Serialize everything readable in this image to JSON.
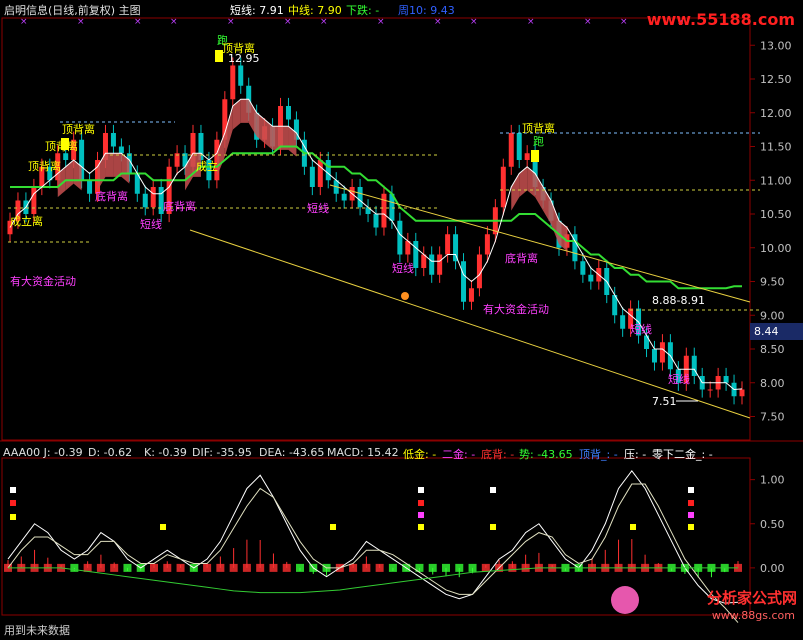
{
  "header": {
    "title": "启明信息(日线,前复权) 主图",
    "short_label": "短线: 7.91",
    "mid_label": "中线: 7.90",
    "down_label": "下跌: -",
    "week_label": "周10: 9.43"
  },
  "brand": {
    "site_top": "www.55188.com",
    "site_bottom_cn": "分析家公式网",
    "site_bottom_url": "www.88gs.com"
  },
  "sub_header": {
    "aaa": "AAA00 J: -0.39",
    "d": "D: -0.62",
    "k": "K: -0.39",
    "dif": "DIF: -35.95",
    "dea": "DEA: -43.65",
    "macd": "MACD: 15.42",
    "low_gold": "低金: -",
    "two_gold": "二金: -",
    "bottom_div": "底背: -",
    "trend": "势: -43.65",
    "top_div": "顶背_: -",
    "press": "压: -",
    "zero_below": "零下二金_: -"
  },
  "bottom_note": "用到未来数据",
  "current_price": "8.44",
  "colors": {
    "up": "#ff3030",
    "down": "#00c0c0",
    "mid": "#33dd33",
    "short": "#ffffff",
    "ribbon": "#c85050",
    "yellow": "#ffff00",
    "magenta": "#ff40ff",
    "green_label": "#33ff33"
  },
  "annotations": [
    {
      "text": "顶背离",
      "color": "#ffff00"
    },
    {
      "text": "顶背离",
      "color": "#ffff00"
    },
    {
      "text": "顶背离",
      "color": "#ffff00"
    },
    {
      "text": "成立离",
      "color": "#ffff00"
    },
    {
      "text": "底背离",
      "color": "#ff40ff"
    },
    {
      "text": "底背离",
      "color": "#ff40ff"
    },
    {
      "text": "短线",
      "color": "#ff40ff"
    },
    {
      "text": "成立",
      "color": "#ffff00"
    },
    {
      "text": "跑",
      "color": "#33ff33"
    },
    {
      "text": "顶背离",
      "color": "#ffff00"
    },
    {
      "text": "12.95",
      "color": "#ffffff"
    },
    {
      "text": "短线",
      "color": "#ff40ff"
    },
    {
      "text": "短线",
      "color": "#ff40ff"
    },
    {
      "text": "有大资金活动",
      "color": "#ff40ff"
    },
    {
      "text": "有大资金活动",
      "color": "#ff40ff"
    },
    {
      "text": "底背离",
      "color": "#ff40ff"
    },
    {
      "text": "顶背离",
      "color": "#ffff00"
    },
    {
      "text": "跑",
      "color": "#33ff33"
    },
    {
      "text": "8.88-8.91",
      "color": "#ffffff"
    },
    {
      "text": "短线",
      "color": "#ff40ff"
    },
    {
      "text": "短线",
      "color": "#ff40ff"
    },
    {
      "text": "7.51",
      "color": "#ffffff"
    }
  ],
  "chart_data": [
    {
      "type": "candlestick",
      "title": "启明信息(日线,前复权) 主图",
      "ylim": [
        7.3,
        13.3
      ],
      "yticks": [
        "7.50",
        "8.00",
        "8.50",
        "9.00",
        "9.50",
        "10.00",
        "10.50",
        "11.00",
        "11.50",
        "12.00",
        "12.50",
        "13.00"
      ],
      "close": [
        10.4,
        10.7,
        10.5,
        10.9,
        11.2,
        11.0,
        11.4,
        11.3,
        11.6,
        11.0,
        10.8,
        11.3,
        11.7,
        11.5,
        11.4,
        11.1,
        10.8,
        10.6,
        10.9,
        10.5,
        11.2,
        11.4,
        11.2,
        11.7,
        11.3,
        11.0,
        11.6,
        12.2,
        12.7,
        12.4,
        12.0,
        11.6,
        11.8,
        11.5,
        12.1,
        11.9,
        11.6,
        11.2,
        10.9,
        11.3,
        11.0,
        10.8,
        10.7,
        10.9,
        10.6,
        10.5,
        10.3,
        10.8,
        10.4,
        9.9,
        10.1,
        9.7,
        9.9,
        9.6,
        9.9,
        10.2,
        9.8,
        9.2,
        9.4,
        9.9,
        10.2,
        10.6,
        11.2,
        11.7,
        11.3,
        11.4,
        10.9,
        10.7,
        10.4,
        10.0,
        10.2,
        9.8,
        9.6,
        9.5,
        9.7,
        9.3,
        9.0,
        8.8,
        9.1,
        8.7,
        8.5,
        8.3,
        8.6,
        8.2,
        8.0,
        8.4,
        8.1,
        7.9,
        7.9,
        8.1,
        8.0,
        7.8,
        7.9
      ],
      "series": [
        {
          "name": "短线",
          "values": [
            10.3,
            10.5,
            10.6,
            10.8,
            10.9,
            11.0,
            11.1,
            11.2,
            11.3,
            11.2,
            11.1,
            11.2,
            11.4,
            11.4,
            11.4,
            11.3,
            11.1,
            10.9,
            10.8,
            10.8,
            10.9,
            11.1,
            11.2,
            11.4,
            11.4,
            11.3,
            11.4,
            11.7,
            12.1,
            12.2,
            12.2,
            12.0,
            11.9,
            11.8,
            11.8,
            11.8,
            11.7,
            11.5,
            11.3,
            11.2,
            11.1,
            11.0,
            10.9,
            10.8,
            10.7,
            10.6,
            10.5,
            10.5,
            10.4,
            10.2,
            10.1,
            10.0,
            9.9,
            9.8,
            9.8,
            9.9,
            9.9,
            9.6,
            9.5,
            9.6,
            9.8,
            10.1,
            10.5,
            10.9,
            11.1,
            11.2,
            11.1,
            10.9,
            10.7,
            10.4,
            10.3,
            10.1,
            9.9,
            9.7,
            9.6,
            9.5,
            9.3,
            9.1,
            9.0,
            8.9,
            8.7,
            8.5,
            8.5,
            8.4,
            8.2,
            8.2,
            8.2,
            8.0,
            8.0,
            8.0,
            8.0,
            7.9,
            7.91
          ]
        },
        {
          "name": "中线",
          "values": [
            10.9,
            10.9,
            10.9,
            10.9,
            10.9,
            10.9,
            10.9,
            11.0,
            11.0,
            11.0,
            11.0,
            11.0,
            11.0,
            11.0,
            11.1,
            11.1,
            11.1,
            11.1,
            11.0,
            11.0,
            11.0,
            11.0,
            11.0,
            11.1,
            11.2,
            11.2,
            11.2,
            11.3,
            11.4,
            11.4,
            11.4,
            11.4,
            11.4,
            11.4,
            11.5,
            11.5,
            11.5,
            11.4,
            11.4,
            11.3,
            11.2,
            11.2,
            11.2,
            11.1,
            11.1,
            11.0,
            11.0,
            10.9,
            10.8,
            10.6,
            10.5,
            10.4,
            10.4,
            10.4,
            10.4,
            10.4,
            10.4,
            10.4,
            10.4,
            10.4,
            10.4,
            10.4,
            10.4,
            10.4,
            10.5,
            10.5,
            10.5,
            10.4,
            10.3,
            10.2,
            10.1,
            10.1,
            10.0,
            9.9,
            9.9,
            9.8,
            9.7,
            9.7,
            9.6,
            9.6,
            9.5,
            9.5,
            9.5,
            9.5,
            9.4,
            9.4,
            9.4,
            9.4,
            9.4,
            9.4,
            9.4,
            9.43,
            9.43
          ]
        }
      ]
    },
    {
      "type": "line",
      "title": "AAA00",
      "ylim": [
        -0.5,
        1.2
      ],
      "yticks": [
        "0.00",
        "0.50",
        "1.00"
      ],
      "series": [
        {
          "name": "J",
          "values": [
            0.1,
            0.3,
            0.5,
            0.4,
            0.2,
            0.1,
            0.2,
            0.4,
            0.3,
            0.1,
            0.0,
            0.1,
            0.2,
            0.1,
            0.0,
            0.1,
            0.3,
            0.6,
            0.9,
            1.05,
            0.8,
            0.5,
            0.2,
            0.0,
            -0.1,
            0.0,
            0.1,
            0.3,
            0.2,
            0.1,
            0.0,
            -0.1,
            -0.2,
            -0.3,
            -0.35,
            -0.3,
            -0.1,
            0.1,
            0.2,
            0.4,
            0.5,
            0.3,
            0.1,
            0.0,
            0.2,
            0.5,
            0.9,
            1.1,
            0.9,
            0.6,
            0.3,
            0.0,
            -0.2,
            -0.35,
            -0.4,
            -0.39
          ]
        },
        {
          "name": "D",
          "values": [
            0.0,
            0.2,
            0.35,
            0.35,
            0.25,
            0.15,
            0.15,
            0.3,
            0.3,
            0.15,
            0.05,
            0.05,
            0.15,
            0.1,
            0.05,
            0.05,
            0.2,
            0.45,
            0.7,
            0.9,
            0.8,
            0.55,
            0.3,
            0.1,
            0.0,
            0.0,
            0.05,
            0.2,
            0.2,
            0.15,
            0.05,
            -0.05,
            -0.15,
            -0.25,
            -0.3,
            -0.3,
            -0.15,
            0.0,
            0.15,
            0.3,
            0.4,
            0.35,
            0.15,
            0.05,
            0.1,
            0.35,
            0.7,
            0.95,
            0.95,
            0.7,
            0.4,
            0.1,
            -0.1,
            -0.3,
            -0.45,
            -0.62
          ]
        },
        {
          "name": "趋势",
          "values": [
            0.0,
            0.0,
            0.0,
            0.0,
            0.0,
            -0.02,
            -0.04,
            -0.06,
            -0.08,
            -0.1,
            -0.12,
            -0.14,
            -0.16,
            -0.18,
            -0.2,
            -0.22,
            -0.24,
            -0.26,
            -0.27,
            -0.28,
            -0.28,
            -0.28,
            -0.28,
            -0.27,
            -0.26,
            -0.25,
            -0.23,
            -0.21,
            -0.19,
            -0.17,
            -0.15,
            -0.13,
            -0.11,
            -0.09,
            -0.07,
            -0.05,
            -0.04,
            -0.03,
            -0.02,
            -0.01,
            0.0,
            0.0,
            0.0,
            0.0,
            0.0,
            0.0,
            0.0,
            0.0,
            0.0,
            0.0,
            0.0,
            0.0,
            0.0,
            0.0,
            0.0,
            0.0
          ]
        }
      ]
    }
  ]
}
